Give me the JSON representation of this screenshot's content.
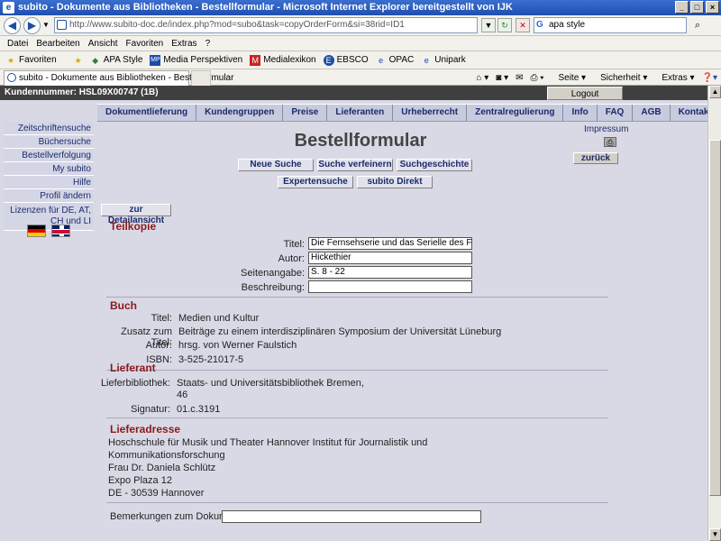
{
  "window": {
    "title": "subito - Dokumente aus Bibliotheken - Bestellformular - Microsoft Internet Explorer bereitgestellt von IJK"
  },
  "browser": {
    "url": "http://www.subito-doc.de/index.php?mod=subo&task=copyOrderForm&si=38rid=ID1",
    "search_value": "apa style",
    "menu": [
      "Datei",
      "Bearbeiten",
      "Ansicht",
      "Favoriten",
      "Extras",
      "?"
    ],
    "favorites_label": "Favoriten",
    "favorites": [
      "APA Style",
      "Media Perspektiven",
      "Medialexikon",
      "EBSCO",
      "OPAC",
      "Unipark"
    ],
    "tab_title": "subito - Dokumente aus Bibliotheken - Bestellformular",
    "commands": [
      "Seite",
      "Sicherheit",
      "Extras"
    ]
  },
  "header": {
    "customer": "Kundennummer: HSL09X00747 (1B)",
    "logout": "Logout"
  },
  "topnav": [
    "Dokumentlieferung",
    "Kundengruppen",
    "Preise",
    "Lieferanten",
    "Urheberrecht",
    "Zentralregulierung",
    "Info",
    "FAQ",
    "AGB",
    "Kontakt"
  ],
  "sidebar": [
    "Zeitschriftensuche",
    "Büchersuche",
    "Bestellverfolgung",
    "My subito",
    "Hilfe",
    "Profil ändern",
    "Lizenzen für DE, AT, CH und LI"
  ],
  "page": {
    "title": "Bestellformular",
    "impressum": "Impressum",
    "back": "zurück",
    "buttons_row1": [
      "Neue Suche",
      "Suche verfeinern",
      "Suchgeschichte"
    ],
    "buttons_row2": [
      "Expertensuche",
      "subito Direkt"
    ],
    "detail_btn": "zur Detailansicht"
  },
  "teilkopie": {
    "heading": "Teilkopie",
    "titel_label": "Titel:",
    "titel_value": "Die Fernsehserie und das Serielle des Fern",
    "autor_label": "Autor:",
    "autor_value": "Hickethier",
    "seiten_label": "Seitenangabe:",
    "seiten_value": "S. 8 - 22",
    "beschr_label": "Beschreibung:",
    "beschr_value": ""
  },
  "buch": {
    "heading": "Buch",
    "titel_label": "Titel:",
    "titel_value": "Medien und Kultur",
    "zusatz_label": "Zusatz zum Titel:",
    "zusatz_value": "Beiträge zu einem interdisziplinären Symposium der Universität Lüneburg",
    "autor_label": "Autor:",
    "autor_value": "hrsg. von Werner Faulstich",
    "isbn_label": "ISBN:",
    "isbn_value": "3-525-21017-5"
  },
  "lieferant": {
    "heading": "Lieferant",
    "bib_label": "Lieferbibliothek:",
    "bib_value1": "Staats- und Universitätsbibliothek Bremen,",
    "bib_value2": "46",
    "sig_label": "Signatur:",
    "sig_value": "01.c.3191"
  },
  "lieferadresse": {
    "heading": "Lieferadresse",
    "lines": [
      "Hoschschule für Musik und Theater Hannover Institut für Journalistik und",
      "Kommunikationsforschung",
      "Frau Dr. Daniela Schlütz",
      "Expo Plaza 12",
      "DE - 30539 Hannover"
    ]
  },
  "bemerkungen": {
    "label": "Bemerkungen zum Dokument",
    "value": ""
  }
}
